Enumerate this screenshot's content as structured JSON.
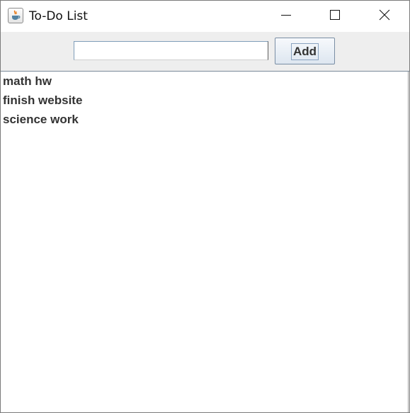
{
  "window": {
    "title": "To-Do List",
    "app_icon": "java-cup-icon",
    "controls": [
      "minimize-icon",
      "maximize-icon",
      "close-icon"
    ]
  },
  "toolbar": {
    "input_value": "",
    "add_label": "Add"
  },
  "list": {
    "items": [
      {
        "label": "math hw"
      },
      {
        "label": "finish website"
      },
      {
        "label": "science work"
      }
    ]
  }
}
